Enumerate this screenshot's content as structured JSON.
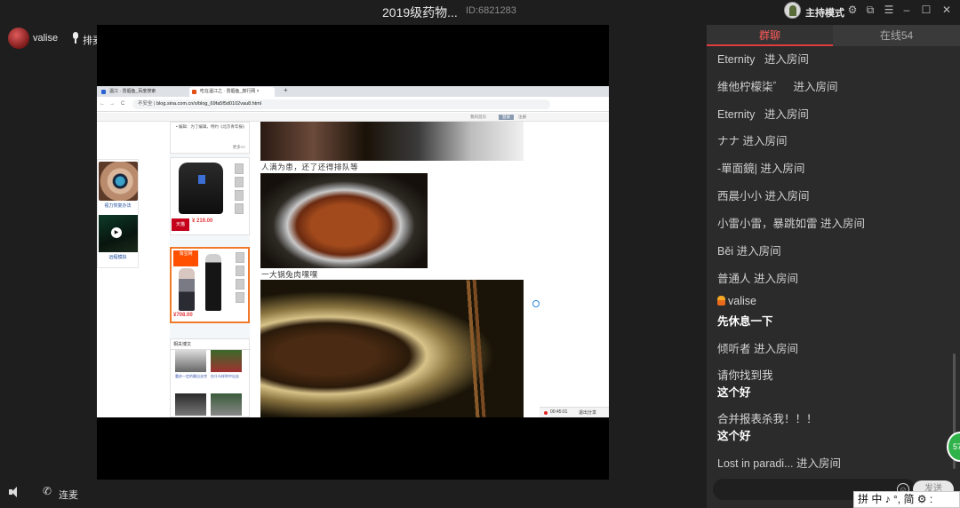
{
  "window": {
    "title": "2019级药物...",
    "room_id": "ID:6821283",
    "host_mode_label": "主持模式",
    "controls": [
      "settings-icon",
      "popout-icon",
      "menu-icon",
      "minimize-icon",
      "maximize-icon",
      "close-icon"
    ]
  },
  "user": {
    "name": "valise",
    "mic_label": "排麦"
  },
  "bottom_controls": {
    "connect_label": "连麦"
  },
  "shared_screen": {
    "browser_tabs": [
      {
        "label": "温江 · 冒烟鱼_百度搜索"
      },
      {
        "label": "吃在温江之 · 冒烟鱼_旅行网 ×"
      }
    ],
    "new_tab_symbol": "+",
    "nav": {
      "back": "←",
      "forward": "→",
      "reload": "C",
      "home": "⌂"
    },
    "insecure_label": "不安全",
    "url": "blog.sina.com.cn/s/blog_69fa5f5d0102vau8.html",
    "blog_toolbar": [
      "我的首页",
      "登录",
      "注册"
    ],
    "left_ad": {
      "caption1": "视力恢复办法",
      "caption2": "远程模拟"
    },
    "side_top_text": "• 编辑：为了编辑，特约《北京青年报》",
    "side_more": "更多>>",
    "product1": {
      "tag": "天猫",
      "price": "¥ 219.00"
    },
    "product2": {
      "brand": "淘宝网",
      "price": "¥708.00"
    },
    "related_head": "相关博文",
    "related": [
      {
        "caption": "重庆一定的最出去完"
      },
      {
        "caption": "在什么样的中出去"
      },
      {
        "caption": ""
      },
      {
        "caption": ""
      }
    ],
    "captions": {
      "line1": "人满为患，还了还得排队等",
      "line2": "一大锅兔肉嘿嘿"
    },
    "recording": {
      "time": "00:45:01",
      "exit_label": "退出分享"
    }
  },
  "chat": {
    "tabs": {
      "group_chat": "群聊",
      "online": "在线54"
    },
    "messages": [
      {
        "type": "system",
        "user": "Eternity",
        "text": "进入房间"
      },
      {
        "type": "system",
        "user": "维他柠檬柒゛",
        "text": "进入房间"
      },
      {
        "type": "system",
        "user": "Eternity",
        "text": "进入房间"
      },
      {
        "type": "system",
        "user": "ナナ",
        "text": "进入房间"
      },
      {
        "type": "system",
        "user": "-單面鏡|",
        "text": "进入房间"
      },
      {
        "type": "system",
        "user": "西晨小小",
        "text": "进入房间"
      },
      {
        "type": "system",
        "user": "小雷小雷，暴跳如雷",
        "text": "进入房间"
      },
      {
        "type": "system",
        "user": "Běi",
        "text": "进入房间"
      },
      {
        "type": "system",
        "user": "普通人",
        "text": "进入房间"
      },
      {
        "type": "user",
        "user": "valise",
        "text": "先休息一下"
      },
      {
        "type": "system",
        "user": "倾听者",
        "text": "进入房间"
      },
      {
        "type": "user",
        "user": "请你找到我",
        "text": "这个好"
      },
      {
        "type": "user",
        "user": "合并报表杀我！！！",
        "text": "这个好"
      },
      {
        "type": "system",
        "user": "Lost in paradi...",
        "text": "进入房间"
      }
    ],
    "send_label": "发送",
    "online_bubble": "57"
  },
  "ime": {
    "text": "拼 中 ♪ °, 简 ⚙ :"
  },
  "colors": {
    "accent": "#e03c3c",
    "online_green": "#2fb24a",
    "panel_bg": "#2b2b2b"
  }
}
